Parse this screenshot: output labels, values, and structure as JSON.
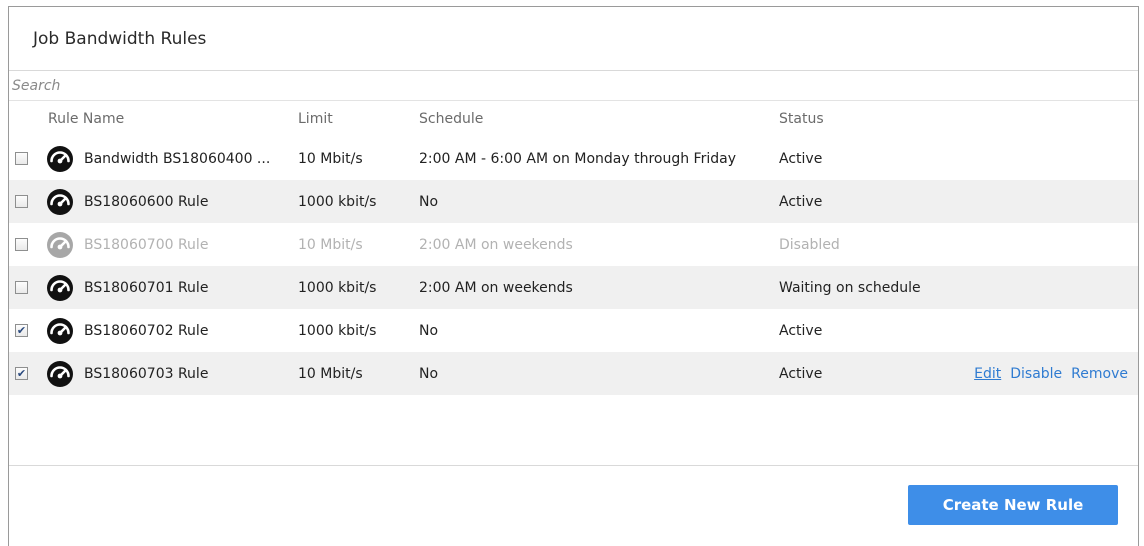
{
  "title": "Job Bandwidth Rules",
  "search": {
    "placeholder": "Search"
  },
  "columns": {
    "name": "Rule Name",
    "limit": "Limit",
    "schedule": "Schedule",
    "status": "Status"
  },
  "rows": [
    {
      "checked": false,
      "name": "Bandwidth BS18060400 ...",
      "limit": "10 Mbit/s",
      "schedule": "2:00 AM - 6:00 AM on Monday through Friday",
      "status": "Active",
      "enabled": true
    },
    {
      "checked": false,
      "name": "BS18060600 Rule",
      "limit": "1000 kbit/s",
      "schedule": "No",
      "status": "Active",
      "enabled": true
    },
    {
      "checked": false,
      "name": "BS18060700 Rule",
      "limit": "10 Mbit/s",
      "schedule": "2:00 AM on weekends",
      "status": "Disabled",
      "enabled": false
    },
    {
      "checked": false,
      "name": "BS18060701 Rule",
      "limit": "1000 kbit/s",
      "schedule": "2:00 AM on weekends",
      "status": "Waiting on schedule",
      "enabled": true
    },
    {
      "checked": true,
      "name": "BS18060702 Rule",
      "limit": "1000 kbit/s",
      "schedule": "No",
      "status": "Active",
      "enabled": true
    },
    {
      "checked": true,
      "name": "BS18060703 Rule",
      "limit": "10 Mbit/s",
      "schedule": "No",
      "status": "Active",
      "enabled": true
    }
  ],
  "row_actions": {
    "edit": "Edit",
    "disable": "Disable",
    "remove": "Remove"
  },
  "create_button": "Create New Rule",
  "colors": {
    "accent": "#3e8ee8",
    "link": "#2f7bd1",
    "row_alt": "#f0f0f0",
    "disabled_text": "#b2b2b2"
  },
  "icons": {
    "rule": "speedometer-gauge-icon",
    "checkbox_checked": "check-mark"
  }
}
